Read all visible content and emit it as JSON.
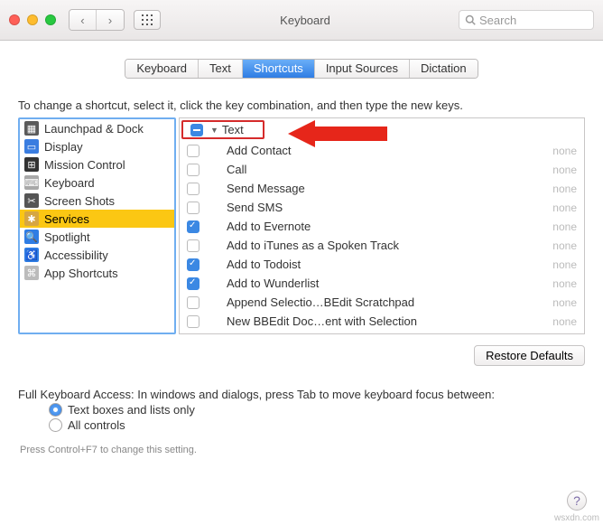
{
  "window": {
    "title": "Keyboard",
    "search_placeholder": "Search"
  },
  "tabs": [
    "Keyboard",
    "Text",
    "Shortcuts",
    "Input Sources",
    "Dictation"
  ],
  "active_tab": 2,
  "instruction": "To change a shortcut, select it, click the key combination, and then type the new keys.",
  "categories": [
    {
      "label": "Launchpad & Dock",
      "icon_bg": "#5b5b5b",
      "icon": "▦"
    },
    {
      "label": "Display",
      "icon_bg": "#3a7de0",
      "icon": "▭"
    },
    {
      "label": "Mission Control",
      "icon_bg": "#333",
      "icon": "⊞"
    },
    {
      "label": "Keyboard",
      "icon_bg": "#a8a8a8",
      "icon": "⌨"
    },
    {
      "label": "Screen Shots",
      "icon_bg": "#555",
      "icon": "✂"
    },
    {
      "label": "Services",
      "icon_bg": "#d6a642",
      "icon": "✱",
      "selected": true
    },
    {
      "label": "Spotlight",
      "icon_bg": "#2f7de4",
      "icon": "🔍"
    },
    {
      "label": "Accessibility",
      "icon_bg": "#2f7de4",
      "icon": "♿"
    },
    {
      "label": "App Shortcuts",
      "icon_bg": "#bbb",
      "icon": "⌘"
    }
  ],
  "group_label": "Text",
  "services": [
    {
      "label": "Add Contact",
      "checked": false,
      "short": "none"
    },
    {
      "label": "Call",
      "checked": false,
      "short": "none"
    },
    {
      "label": "Send Message",
      "checked": false,
      "short": "none"
    },
    {
      "label": "Send SMS",
      "checked": false,
      "short": "none"
    },
    {
      "label": "Add to Evernote",
      "checked": true,
      "short": "none"
    },
    {
      "label": "Add to iTunes as a Spoken Track",
      "checked": false,
      "short": "none"
    },
    {
      "label": "Add to Todoist",
      "checked": true,
      "short": "none"
    },
    {
      "label": "Add to Wunderlist",
      "checked": true,
      "short": "none"
    },
    {
      "label": "Append Selectio…BEdit Scratchpad",
      "checked": false,
      "short": "none"
    },
    {
      "label": "New BBEdit Doc…ent with Selection",
      "checked": false,
      "short": "none"
    }
  ],
  "restore_label": "Restore Defaults",
  "fka": {
    "text": "Full Keyboard Access: In windows and dialogs, press Tab to move keyboard focus between:",
    "opt1": "Text boxes and lists only",
    "opt2": "All controls",
    "hint": "Press Control+F7 to change this setting."
  },
  "watermark": "wsxdn.com"
}
